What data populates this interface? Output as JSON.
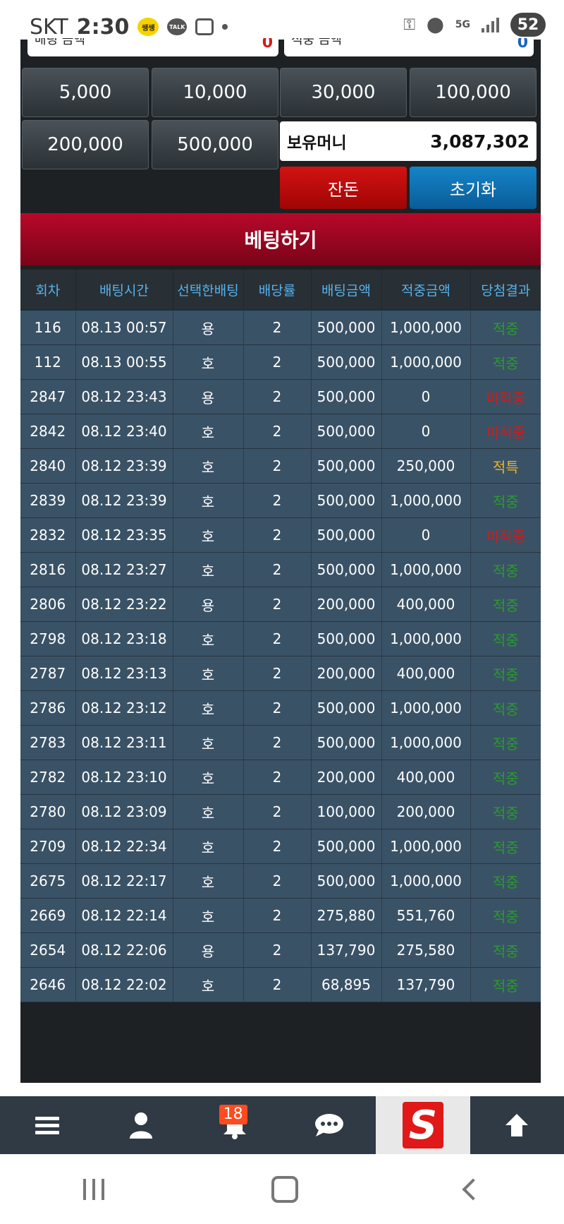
{
  "status_bar": {
    "carrier": "SKT",
    "time": "2:30",
    "kakao_label": "쌩쌩",
    "talk_label": "TALK",
    "network": "5G",
    "battery": "52"
  },
  "top_inputs": {
    "left_label": "배팅 금액",
    "left_value": "0",
    "right_label": "적중 금액",
    "right_value": "0"
  },
  "amount_buttons": [
    "5,000",
    "10,000",
    "30,000",
    "100,000",
    "200,000",
    "500,000"
  ],
  "money": {
    "label": "보유머니",
    "value": "3,087,302"
  },
  "buttons": {
    "change": "잔돈",
    "reset": "초기화",
    "bet": "베팅하기"
  },
  "table": {
    "headers": [
      "회차",
      "배팅시간",
      "선택한배팅",
      "배당률",
      "배팅금액",
      "적중금액",
      "당첨결과"
    ],
    "rows": [
      [
        "116",
        "08.13 00:57",
        "용",
        "2",
        "500,000",
        "1,000,000",
        "적중"
      ],
      [
        "112",
        "08.13 00:55",
        "호",
        "2",
        "500,000",
        "1,000,000",
        "적중"
      ],
      [
        "2847",
        "08.12 23:43",
        "용",
        "2",
        "500,000",
        "0",
        "미적중"
      ],
      [
        "2842",
        "08.12 23:40",
        "호",
        "2",
        "500,000",
        "0",
        "미적중"
      ],
      [
        "2840",
        "08.12 23:39",
        "호",
        "2",
        "500,000",
        "250,000",
        "적특"
      ],
      [
        "2839",
        "08.12 23:39",
        "호",
        "2",
        "500,000",
        "1,000,000",
        "적중"
      ],
      [
        "2832",
        "08.12 23:35",
        "호",
        "2",
        "500,000",
        "0",
        "미적중"
      ],
      [
        "2816",
        "08.12 23:27",
        "호",
        "2",
        "500,000",
        "1,000,000",
        "적중"
      ],
      [
        "2806",
        "08.12 23:22",
        "용",
        "2",
        "200,000",
        "400,000",
        "적중"
      ],
      [
        "2798",
        "08.12 23:18",
        "호",
        "2",
        "500,000",
        "1,000,000",
        "적중"
      ],
      [
        "2787",
        "08.12 23:13",
        "호",
        "2",
        "200,000",
        "400,000",
        "적중"
      ],
      [
        "2786",
        "08.12 23:12",
        "호",
        "2",
        "500,000",
        "1,000,000",
        "적중"
      ],
      [
        "2783",
        "08.12 23:11",
        "호",
        "2",
        "500,000",
        "1,000,000",
        "적중"
      ],
      [
        "2782",
        "08.12 23:10",
        "호",
        "2",
        "200,000",
        "400,000",
        "적중"
      ],
      [
        "2780",
        "08.12 23:09",
        "호",
        "2",
        "100,000",
        "200,000",
        "적중"
      ],
      [
        "2709",
        "08.12 22:34",
        "호",
        "2",
        "500,000",
        "1,000,000",
        "적중"
      ],
      [
        "2675",
        "08.12 22:17",
        "호",
        "2",
        "500,000",
        "1,000,000",
        "적중"
      ],
      [
        "2669",
        "08.12 22:14",
        "호",
        "2",
        "275,880",
        "551,760",
        "적중"
      ],
      [
        "2654",
        "08.12 22:06",
        "용",
        "2",
        "137,790",
        "275,580",
        "적중"
      ],
      [
        "2646",
        "08.12 22:02",
        "호",
        "2",
        "68,895",
        "137,790",
        "적중"
      ]
    ]
  },
  "bottom_nav": {
    "notification_count": "18",
    "items": [
      "menu-icon",
      "user-icon",
      "bell-icon",
      "chat-icon",
      "brand-logo",
      "arrow-up-icon"
    ],
    "brand_letter": "S"
  },
  "colors": {
    "win": "#2a9b2e",
    "lose": "#d31a1a",
    "special": "#f0b21c",
    "bet_bar": "#a0061f",
    "reset_button": "#0a6fb3",
    "change_button": "#c10d0d"
  }
}
